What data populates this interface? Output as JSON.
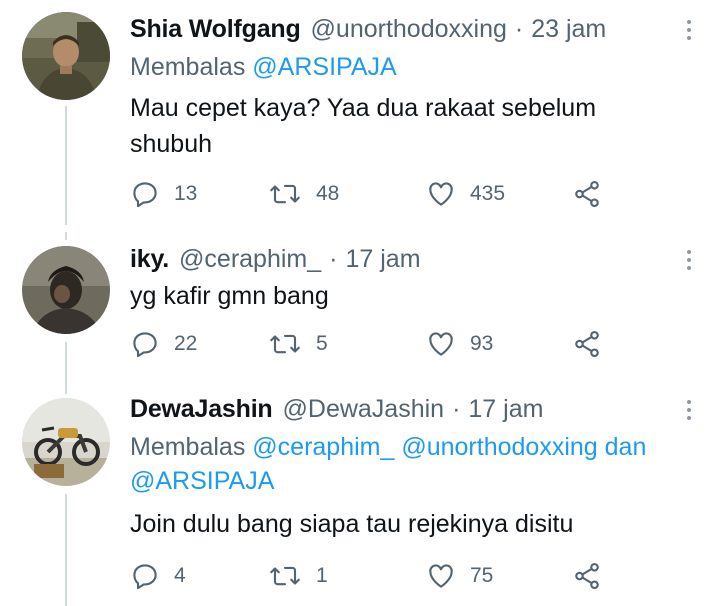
{
  "tweets": [
    {
      "name": "Shia Wolfgang",
      "handle": "@unorthodoxxing",
      "separator": "·",
      "time": "23 jam",
      "reply_prefix": "Membalas",
      "reply_to": [
        "@ARSIPAJA"
      ],
      "text": "Mau cepet kaya? Yaa dua rakaat sebelum shubuh",
      "replies": "13",
      "retweets": "48",
      "likes": "435"
    },
    {
      "name": "iky.",
      "handle": "@ceraphim_",
      "separator": "·",
      "time": "17 jam",
      "text": "yg kafir gmn bang",
      "replies": "22",
      "retweets": "5",
      "likes": "93"
    },
    {
      "name": "DewaJashin",
      "handle": "@DewaJashin",
      "separator": "·",
      "time": "17 jam",
      "reply_prefix": "Membalas",
      "reply_to": [
        "@ceraphim_",
        "@unorthodoxxing",
        "@ARSIPAJA"
      ],
      "reply_joiner": "dan",
      "text": "Join dulu bang siapa tau rejekinya disitu",
      "replies": "4",
      "retweets": "1",
      "likes": "75"
    }
  ],
  "icons": {
    "reply": "reply-icon",
    "retweet": "retweet-icon",
    "like": "heart-icon",
    "share": "share-icon",
    "more": "more-icon"
  },
  "colors": {
    "text": "#0f1419",
    "secondary": "#536471",
    "link": "#1d9bf0",
    "thread_line": "#cfd9de"
  }
}
